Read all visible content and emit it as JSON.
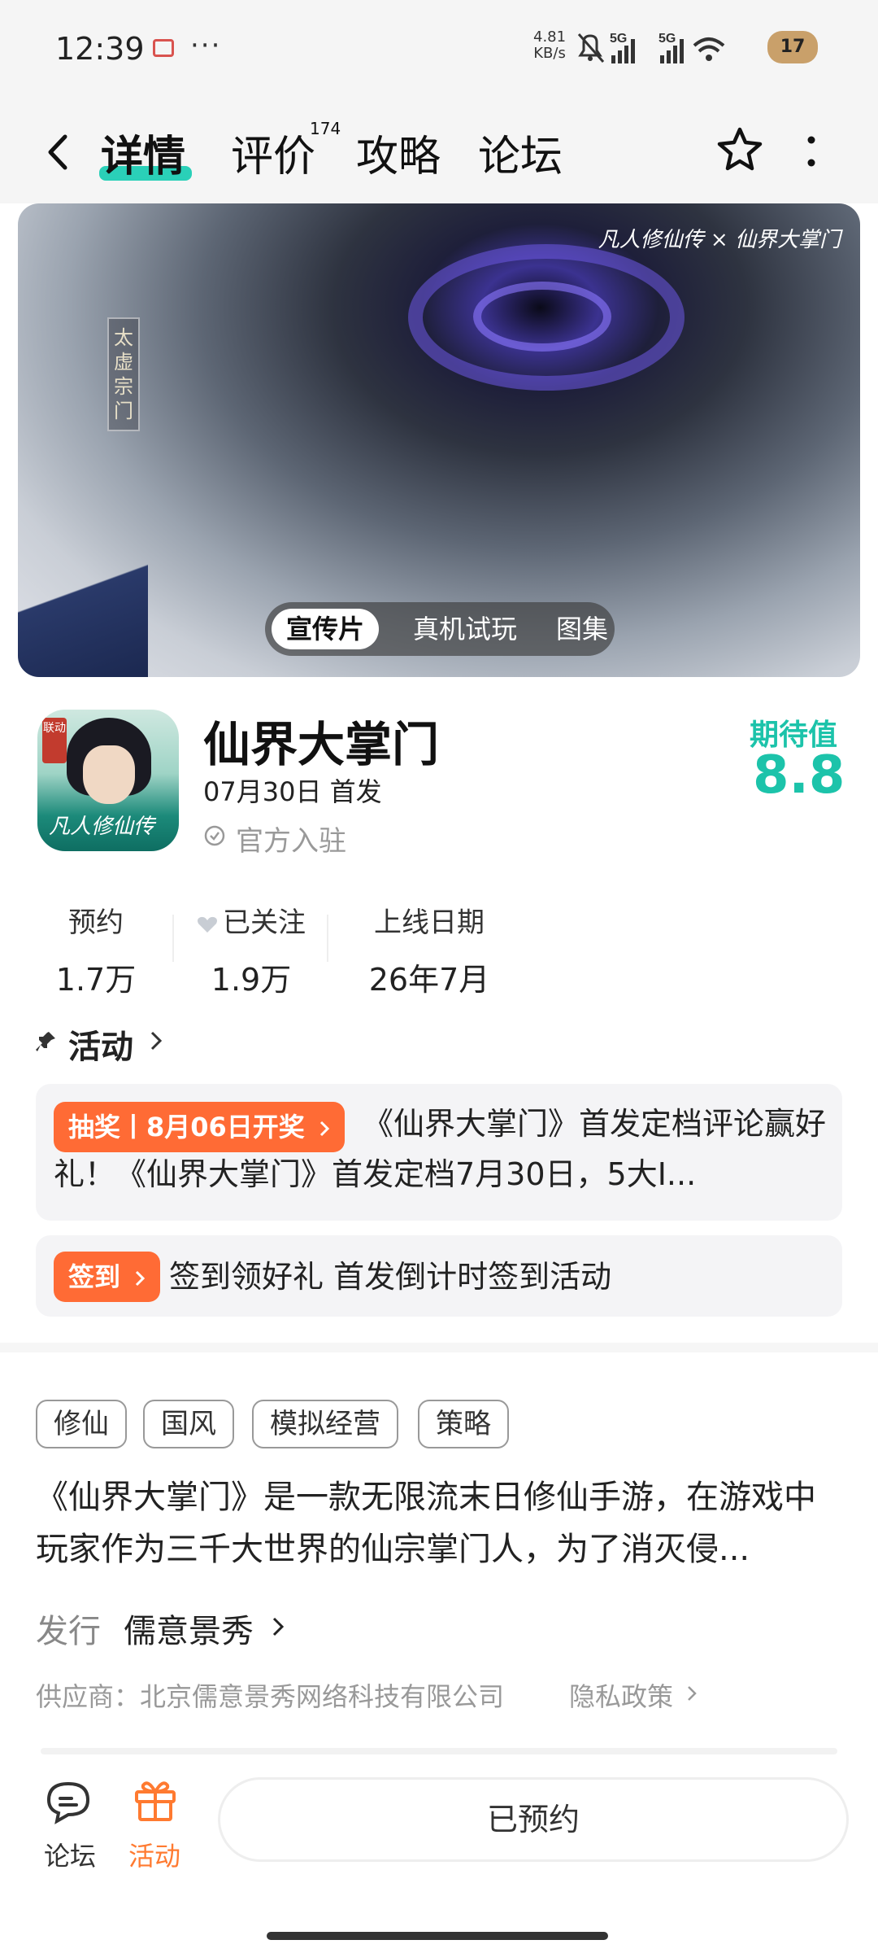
{
  "status_bar": {
    "time": "12:39",
    "dots": "···",
    "speed_value": "4.81",
    "speed_unit": "KB/s",
    "signal1": "5G",
    "signal2": "5G",
    "battery": "17",
    "icons": [
      "book-icon",
      "mute-icon",
      "signal-icon",
      "wifi-icon",
      "battery-icon"
    ]
  },
  "header": {
    "tabs": [
      {
        "label": "详情",
        "active": true
      },
      {
        "label": "评价",
        "count": "174"
      },
      {
        "label": "攻略"
      },
      {
        "label": "论坛"
      }
    ],
    "accent": "#2ad0b8"
  },
  "banner": {
    "logo_text": "凡人修仙传 × 仙界大掌门",
    "sign_text": "太虚宗门",
    "media_tabs": [
      "宣传片",
      "真机试玩",
      "图集"
    ]
  },
  "game": {
    "title": "仙界大掌门",
    "release": "07月30日 首发",
    "official": "官方入驻",
    "icon_badge": "联动",
    "icon_script": "凡人修仙传",
    "expect_label": "期待值",
    "expect_value": "8.8",
    "expect_color": "#1cc3aa"
  },
  "stats": [
    {
      "label": "预约",
      "value": "1.7万"
    },
    {
      "label": "已关注",
      "value": "1.9万"
    },
    {
      "label": "上线日期",
      "value": "26年7月"
    }
  ],
  "activity": {
    "title": "活动",
    "items": [
      {
        "badge": "抽奖丨8月06日开奖",
        "text": "《仙界大掌门》首发定档评论赢好礼！《仙界大掌门》首发定档7月30日，5大I..."
      },
      {
        "badge": "签到",
        "text": "签到领好礼 首发倒计时签到活动"
      }
    ],
    "badge_color": "#ff6b35"
  },
  "tags": [
    "修仙",
    "国风",
    "模拟经营",
    "策略"
  ],
  "description": "《仙界大掌门》是一款无限流末日修仙手游，在游戏中玩家作为三千大世界的仙宗掌门人，为了消灭侵...",
  "publisher": {
    "label": "发行",
    "value": "儒意景秀"
  },
  "supplier": "供应商：北京儒意景秀网络科技有限公司",
  "privacy": "隐私政策",
  "bottom_bar": {
    "forum_label": "论坛",
    "activity_label": "活动",
    "reserved_label": "已预约",
    "activity_color": "#ff7a30"
  }
}
